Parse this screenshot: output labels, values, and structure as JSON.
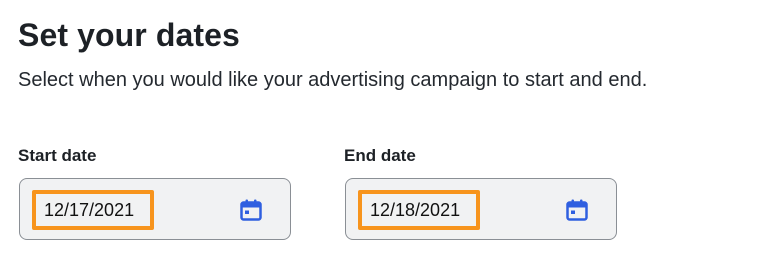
{
  "header": {
    "title": "Set your dates",
    "subtitle": "Select when you would like your advertising campaign to start and end."
  },
  "fields": {
    "start": {
      "label": "Start date",
      "value": "12/17/2021",
      "icon": "calendar-icon"
    },
    "end": {
      "label": "End date",
      "value": "12/18/2021",
      "icon": "calendar-icon"
    }
  },
  "colors": {
    "highlight": "#f7941d",
    "calendar_icon": "#2f5fe0",
    "input_background": "#f1f2f3",
    "input_border": "#8a8f95"
  }
}
